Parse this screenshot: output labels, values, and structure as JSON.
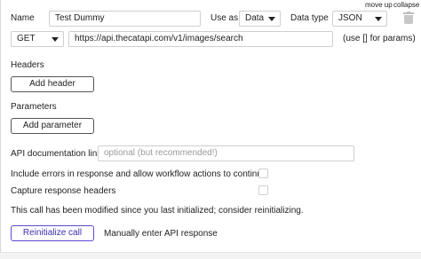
{
  "header": {
    "move_up": "move up",
    "collapse": "collapse",
    "delete_icon": "trash-icon"
  },
  "call": {
    "name_label": "Name",
    "name_value": "Test Dummy",
    "use_as_label": "Use as",
    "use_as_value": "Data",
    "data_type_label": "Data type",
    "data_type_value": "JSON",
    "method_value": "GET",
    "url_value": "https://api.thecatapi.com/v1/images/search",
    "params_hint": "(use [] for params)"
  },
  "headers": {
    "title": "Headers",
    "add_label": "Add header"
  },
  "parameters": {
    "title": "Parameters",
    "add_label": "Add parameter"
  },
  "documentation": {
    "label": "API documentation link",
    "placeholder": "optional (but recommended!)"
  },
  "options": {
    "include_errors_label": "Include errors in response and allow workflow actions to continue",
    "include_errors_checked": false,
    "capture_headers_label": "Capture response headers",
    "capture_headers_checked": false
  },
  "status": {
    "modified_message": "This call has been modified since you last initialized; consider reinitializing."
  },
  "actions": {
    "reinitialize_label": "Reinitialize call",
    "manual_label": "Manually enter API response"
  },
  "colors": {
    "accent": "#5a4bd1",
    "border": "#cfcfcf",
    "text": "#222222",
    "placeholder": "#9a9a9a"
  }
}
